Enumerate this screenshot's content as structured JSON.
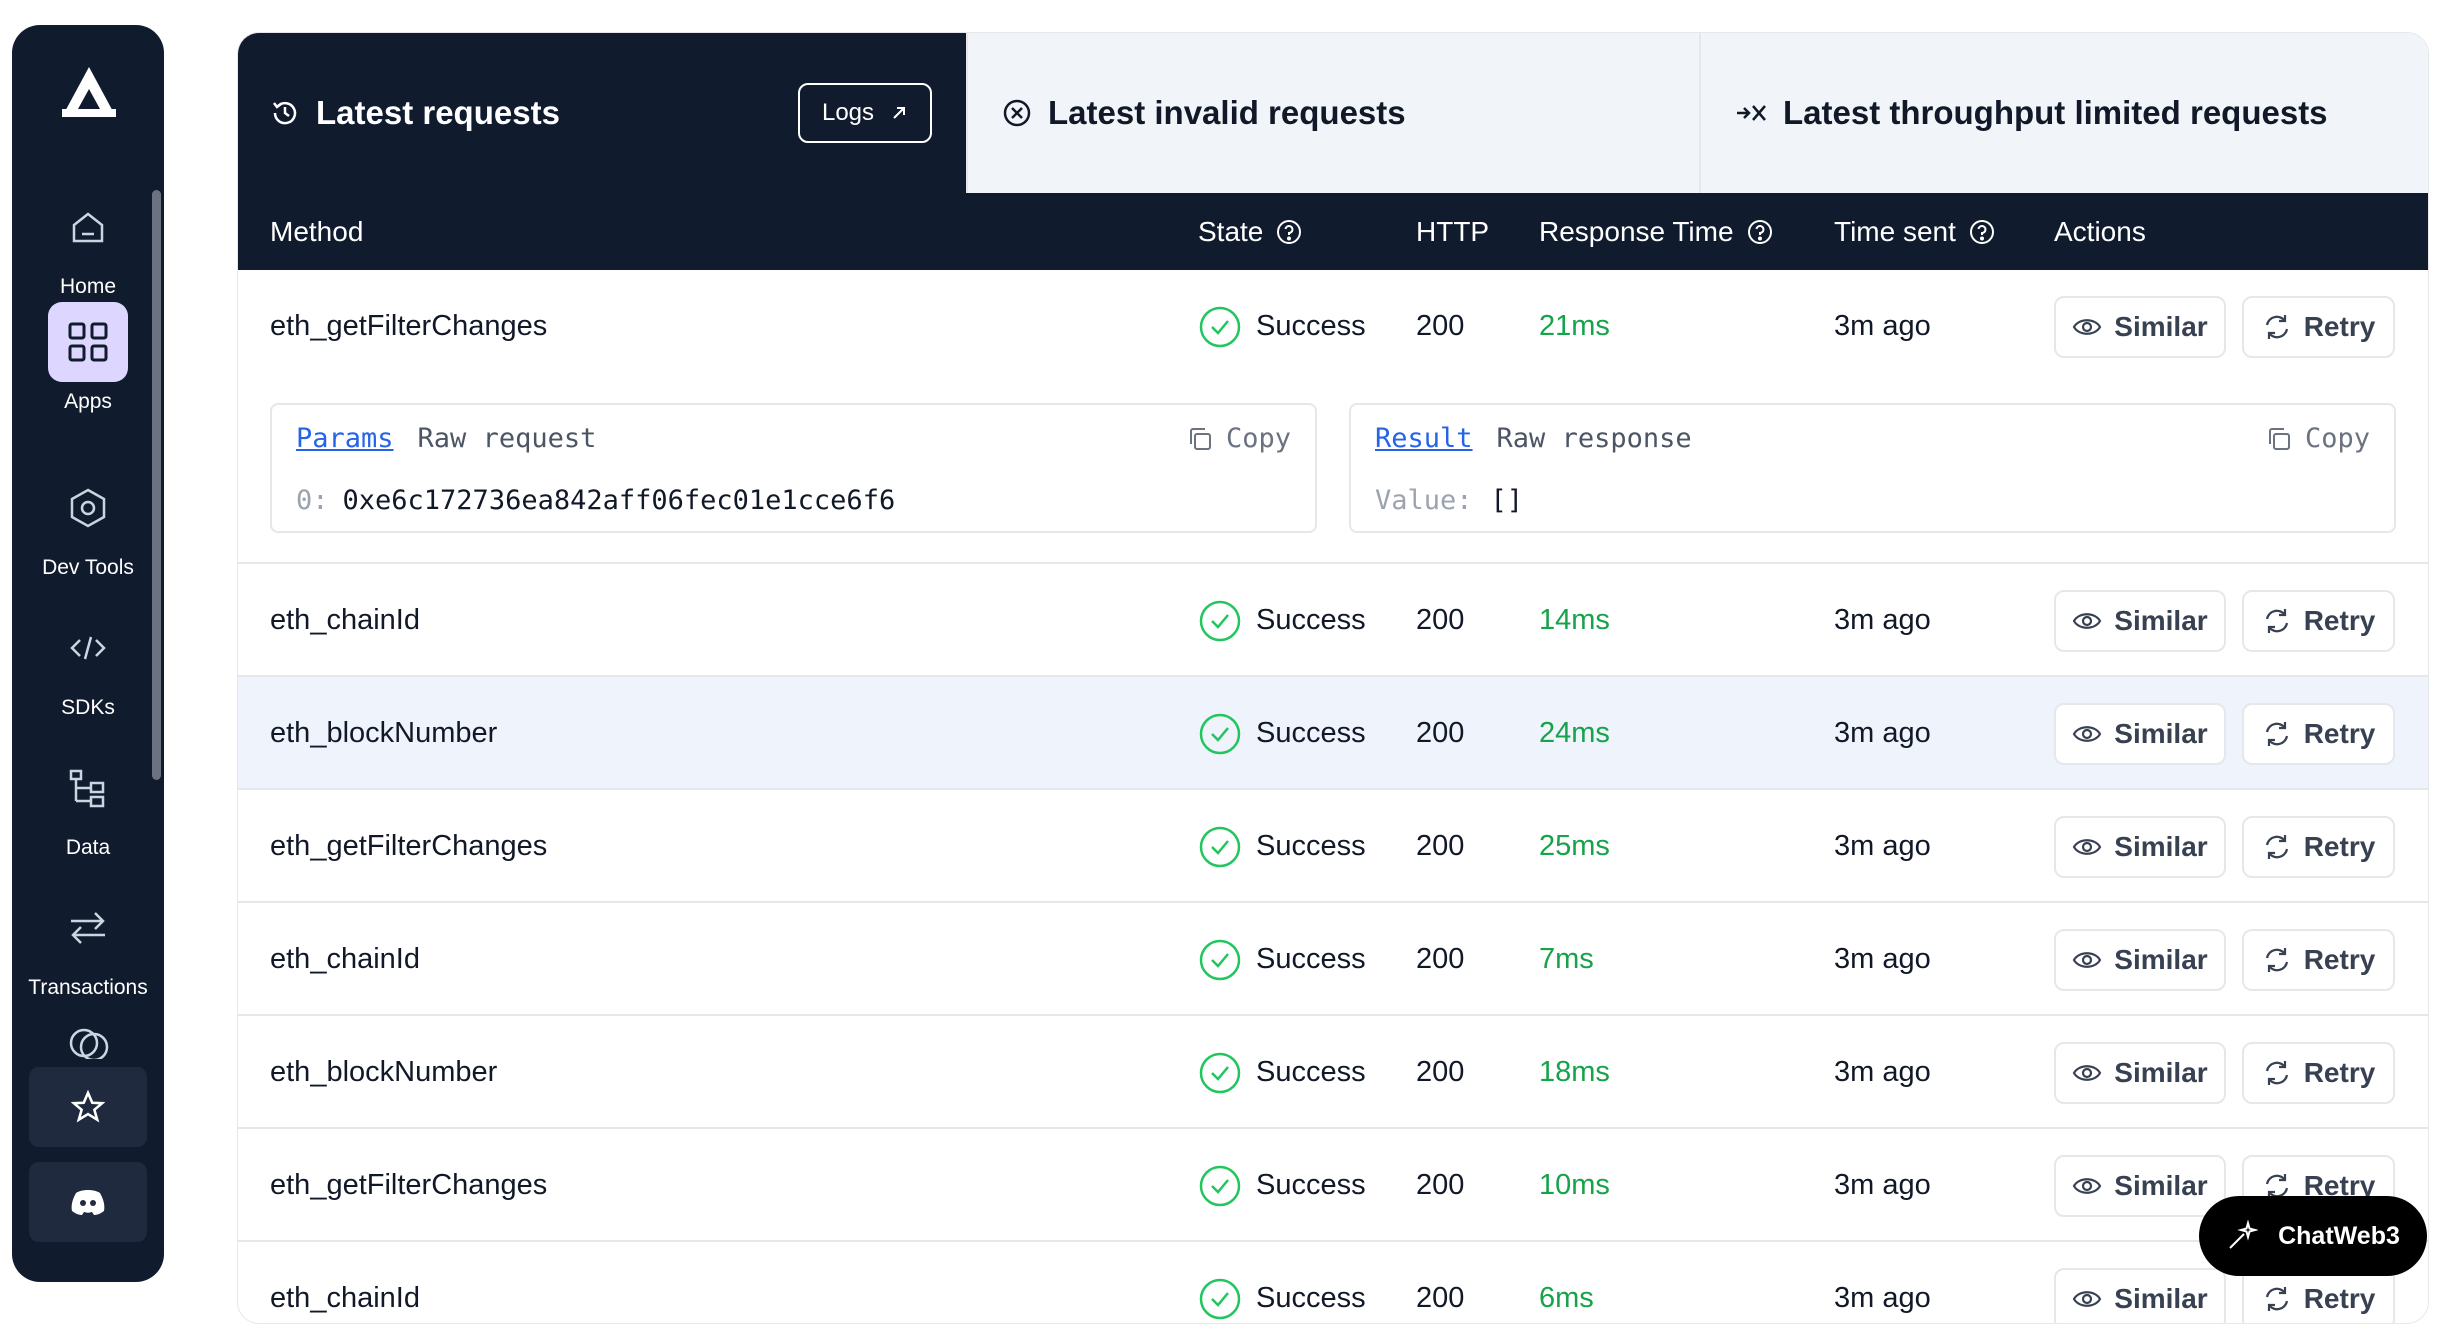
{
  "sidebar": {
    "items": [
      {
        "label": "Home",
        "icon": "home-icon"
      },
      {
        "label": "Apps",
        "icon": "apps-grid-icon",
        "active": true
      },
      {
        "label": "Dev Tools",
        "icon": "hexagon-icon"
      },
      {
        "label": "SDKs",
        "icon": "code-icon"
      },
      {
        "label": "Data",
        "icon": "data-tree-icon"
      },
      {
        "label": "Transactions",
        "icon": "transactions-icon"
      }
    ],
    "bottom": [
      "star-icon",
      "discord-icon"
    ]
  },
  "tabs": {
    "latest": "Latest requests",
    "logs": "Logs",
    "invalid": "Latest invalid requests",
    "throughput": "Latest throughput limited requests"
  },
  "table": {
    "headers": {
      "method": "Method",
      "state": "State",
      "http": "HTTP",
      "response_time": "Response Time",
      "time_sent": "Time sent",
      "actions": "Actions"
    },
    "similar_label": "Similar",
    "retry_label": "Retry",
    "rows": [
      {
        "method": "eth_getFilterChanges",
        "state": "Success",
        "http": "200",
        "response_time": "21ms",
        "time_sent": "3m ago"
      },
      {
        "method": "eth_chainId",
        "state": "Success",
        "http": "200",
        "response_time": "14ms",
        "time_sent": "3m ago"
      },
      {
        "method": "eth_blockNumber",
        "state": "Success",
        "http": "200",
        "response_time": "24ms",
        "time_sent": "3m ago"
      },
      {
        "method": "eth_getFilterChanges",
        "state": "Success",
        "http": "200",
        "response_time": "25ms",
        "time_sent": "3m ago"
      },
      {
        "method": "eth_chainId",
        "state": "Success",
        "http": "200",
        "response_time": "7ms",
        "time_sent": "3m ago"
      },
      {
        "method": "eth_blockNumber",
        "state": "Success",
        "http": "200",
        "response_time": "18ms",
        "time_sent": "3m ago"
      },
      {
        "method": "eth_getFilterChanges",
        "state": "Success",
        "http": "200",
        "response_time": "10ms",
        "time_sent": "3m ago"
      },
      {
        "method": "eth_chainId",
        "state": "Success",
        "http": "200",
        "response_time": "6ms",
        "time_sent": "3m ago"
      }
    ]
  },
  "detail": {
    "params_tab": "Params",
    "raw_request_tab": "Raw request",
    "copy": "Copy",
    "param_key": "0:",
    "param_value": "0xe6c172736ea842aff06fec01e1cce6f6",
    "result_tab": "Result",
    "raw_response_tab": "Raw response",
    "result_key": "Value:",
    "result_value": "[]"
  },
  "chat": {
    "label": "ChatWeb3"
  },
  "colors": {
    "navy": "#111b2e",
    "success": "#16a34a",
    "link": "#2563eb",
    "apps_active": "#ddd6fe"
  }
}
